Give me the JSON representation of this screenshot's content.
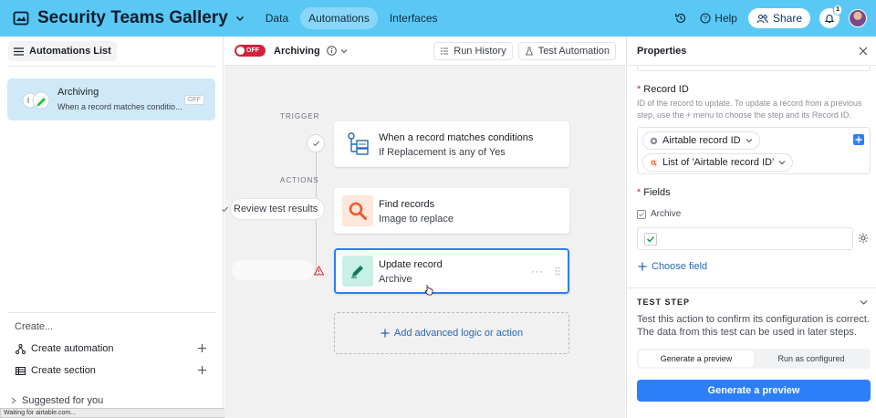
{
  "app": {
    "base_title": "Security Teams Gallery",
    "nav": [
      "Data",
      "Automations",
      "Interfaces"
    ],
    "help_label": "Help",
    "share_label": "Share",
    "notification_count": "1",
    "accent": "#5ac8f5"
  },
  "sidebar": {
    "list_button": "Automations List",
    "automation": {
      "name": "Archiving",
      "description": "When a record matches conditio...",
      "status": "OFF"
    },
    "create_title": "Create...",
    "create_items": [
      "Create automation",
      "Create section"
    ],
    "suggested": "Suggested for you",
    "browser_status": "Waiting for airtable.com..."
  },
  "canvas": {
    "toggle_label": "OFF",
    "automation_title": "Archiving",
    "run_history": "Run History",
    "test_automation": "Test Automation",
    "trigger_label": "TRIGGER",
    "actions_label": "ACTIONS",
    "review_label": "Review test results",
    "steps": [
      {
        "title": "When a record matches conditions",
        "subtitle": "If Replacement is any of Yes",
        "icon": "trigger-conditions-icon"
      },
      {
        "title": "Find records",
        "subtitle": "Image to replace",
        "icon": "magnifier-icon"
      },
      {
        "title": "Update record",
        "subtitle": "Archive",
        "icon": "pencil-icon"
      }
    ],
    "add_logic": "Add advanced logic or action"
  },
  "panel": {
    "title": "Properties",
    "record_id_label": "Record ID",
    "record_id_help": "ID of the record to update. To update a record from a previous step, use the + menu to choose the step and its Record ID.",
    "chip_1": "Airtable record ID",
    "chip_2": "List of 'Airtable record ID'",
    "fields_label": "Fields",
    "field_name": "Archive",
    "choose_field": "Choose field",
    "test_step_title": "TEST STEP",
    "test_step_desc": "Test this action to confirm its configuration is correct. The data from this test can be used in later steps.",
    "seg_options": [
      "Generate a preview",
      "Run as configured"
    ],
    "generate_button": "Generate a preview"
  }
}
